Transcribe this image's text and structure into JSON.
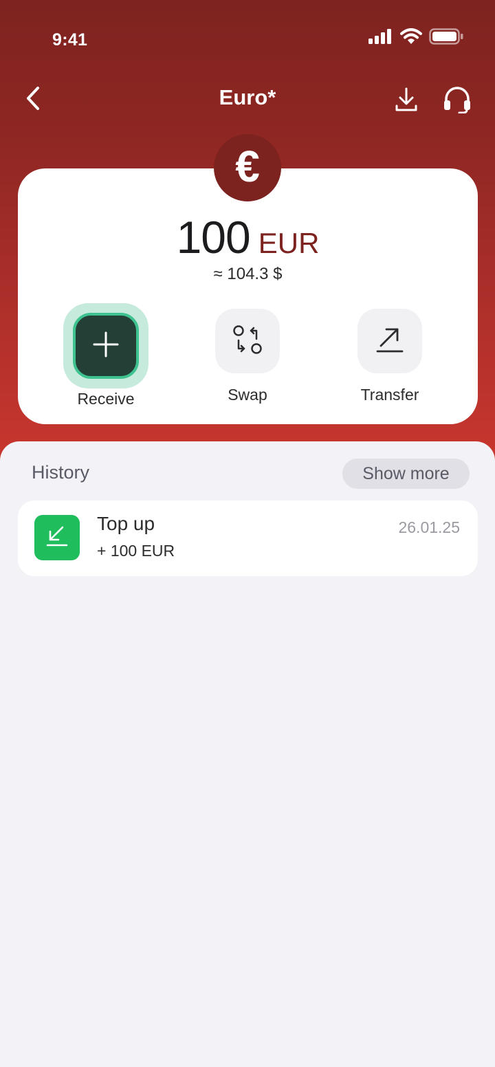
{
  "status_bar": {
    "time": "9:41",
    "icons": [
      "signal-icon",
      "wifi-icon",
      "battery-icon"
    ]
  },
  "header": {
    "title": "Euro*",
    "back_icon": "chevron-left-icon",
    "download_icon": "download-icon",
    "support_icon": "headset-icon"
  },
  "balance": {
    "currency_symbol": "€",
    "amount": "100",
    "currency_code": "EUR",
    "approx_value": "≈ 104.3  $"
  },
  "actions": [
    {
      "label": "Receive",
      "icon": "plus-icon"
    },
    {
      "label": "Swap",
      "icon": "swap-icon"
    },
    {
      "label": "Transfer",
      "icon": "arrow-up-right-icon"
    }
  ],
  "history": {
    "title": "History",
    "show_more_label": "Show more",
    "items": [
      {
        "title": "Top up",
        "amount": "+ 100 EUR",
        "date": "26.01.25",
        "icon": "arrow-down-left-icon"
      }
    ]
  },
  "colors": {
    "brand": "#7c2320",
    "hero_top": "#7e2320",
    "hero_bottom": "#c9362f",
    "receive_button": "#243f36",
    "receive_ring": "#3ec28f",
    "receive_halo": "#c6eadc",
    "topup_icon_bg": "#1fbd5c"
  }
}
